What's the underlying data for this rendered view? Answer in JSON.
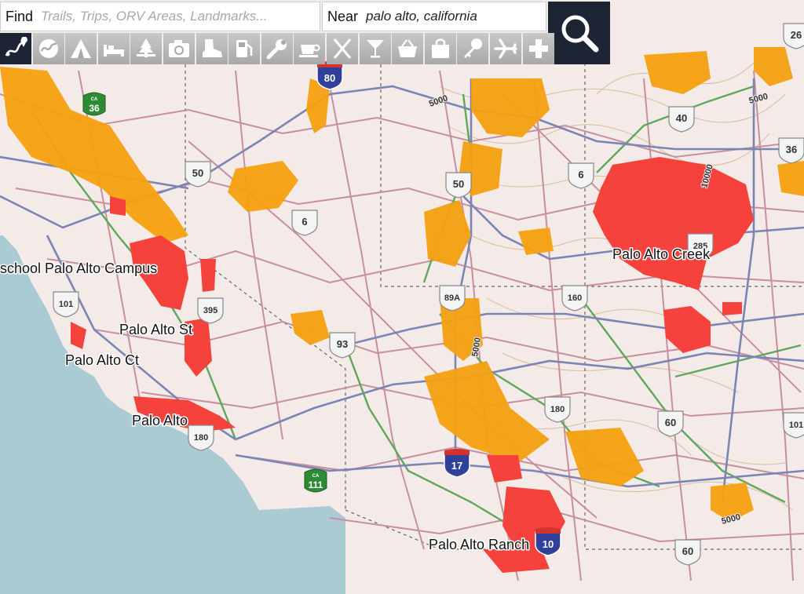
{
  "search": {
    "find_label": "Find",
    "find_placeholder": "Trails, Trips, ORV Areas, Landmarks...",
    "near_label": "Near",
    "near_value": "palo alto, california"
  },
  "toolbar": {
    "items": [
      {
        "name": "trails-icon",
        "selected": true
      },
      {
        "name": "orv-icon"
      },
      {
        "name": "camping-icon"
      },
      {
        "name": "lodging-icon"
      },
      {
        "name": "picnic-icon"
      },
      {
        "name": "camera-icon"
      },
      {
        "name": "hiking-boot-icon"
      },
      {
        "name": "fuel-icon"
      },
      {
        "name": "wrench-icon"
      },
      {
        "name": "coffee-icon"
      },
      {
        "name": "dining-icon"
      },
      {
        "name": "bar-icon"
      },
      {
        "name": "basket-icon"
      },
      {
        "name": "shopping-bag-icon"
      },
      {
        "name": "key-icon"
      },
      {
        "name": "airport-icon"
      },
      {
        "name": "medical-cross-icon"
      }
    ]
  },
  "colors": {
    "water": "#aacbd3",
    "land": "#f4ebe8",
    "road": "#c88e9e",
    "highway": "#7b85b5",
    "green_route": "#5ea85e",
    "trail": "#f5a10f",
    "red_area": "#f5423d",
    "contour": "#d4b68f",
    "toolbar_dark": "#1d2434"
  },
  "map": {
    "places": [
      {
        "text": "Palo Alto Creek"
      },
      {
        "text": "school Palo Alto Campus"
      },
      {
        "text": "Palo Alto St"
      },
      {
        "text": "Palo Alto Ct"
      },
      {
        "text": "Palo Alto"
      },
      {
        "text": "Palo Alto Ranch"
      }
    ],
    "us_routes": [
      "26",
      "40",
      "36",
      "50",
      "6",
      "6",
      "50",
      "285",
      "89A",
      "160",
      "395",
      "101",
      "93",
      "180",
      "60",
      "101",
      "180",
      "60"
    ],
    "interstates": [
      "80",
      "17",
      "10"
    ],
    "state_routes": [
      {
        "state": "CA",
        "num": "36"
      },
      {
        "state": "CA",
        "num": "111"
      }
    ],
    "contour_labels": [
      "5000",
      "5000",
      "10000",
      "5000",
      "5000"
    ]
  }
}
